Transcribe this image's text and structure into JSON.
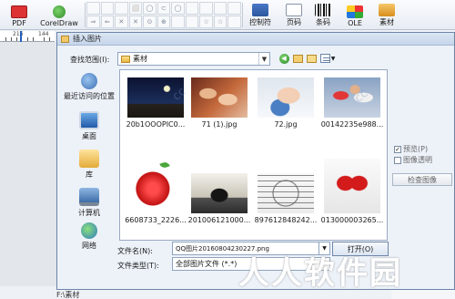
{
  "toolbar": {
    "pdf_label": "PDF",
    "coreldraw_label": "CorelDraw",
    "control_label": "控制符",
    "page_label": "页码",
    "barcode_label": "条码",
    "ole_label": "OLE",
    "material_label": "素材",
    "shape_glyphs": [
      "",
      "",
      "",
      "⬜",
      "◯",
      "⊂",
      "◯",
      "",
      "",
      "",
      "",
      "⇒",
      "⇐",
      "✕",
      "✕",
      "⊙",
      "⊕",
      "",
      "",
      "☆",
      "☆",
      ""
    ]
  },
  "ruler": {
    "left_num": "216",
    "right_num": "144"
  },
  "dialog": {
    "title": "插入图片",
    "lookin_label": "查找范围(I):",
    "lookin_value": "素材",
    "places": [
      {
        "label": "最近访问的位置"
      },
      {
        "label": "桌面"
      },
      {
        "label": "库"
      },
      {
        "label": "计算机"
      },
      {
        "label": "网络"
      }
    ],
    "files": [
      {
        "name": "20b1OOOPIC0..."
      },
      {
        "name": "71 (1).jpg"
      },
      {
        "name": "72.jpg"
      },
      {
        "name": "00142235e988..."
      },
      {
        "name": "6608733_2226..."
      },
      {
        "name": "201006121000..."
      },
      {
        "name": "897612848242..."
      },
      {
        "name": "013000003265..."
      }
    ],
    "preview_label": "预览(P)",
    "preview_checked": "✓",
    "transparent_label": "图像透明",
    "check_image_label": "检查图像",
    "filename_label": "文件名(N):",
    "filename_value": "QQ图片20160804230227.png",
    "filetype_label": "文件类型(T):",
    "filetype_value": "全部图片文件 (*.*)",
    "open_label": "打开(O)"
  },
  "status": {
    "path": "F:\\素材"
  },
  "watermark": {
    "cc1": "cc",
    "cc2": "cc",
    "brand": "人人软件园"
  },
  "colors": {
    "dialog_border": "#6b83a6",
    "accent": "#2060c0"
  }
}
